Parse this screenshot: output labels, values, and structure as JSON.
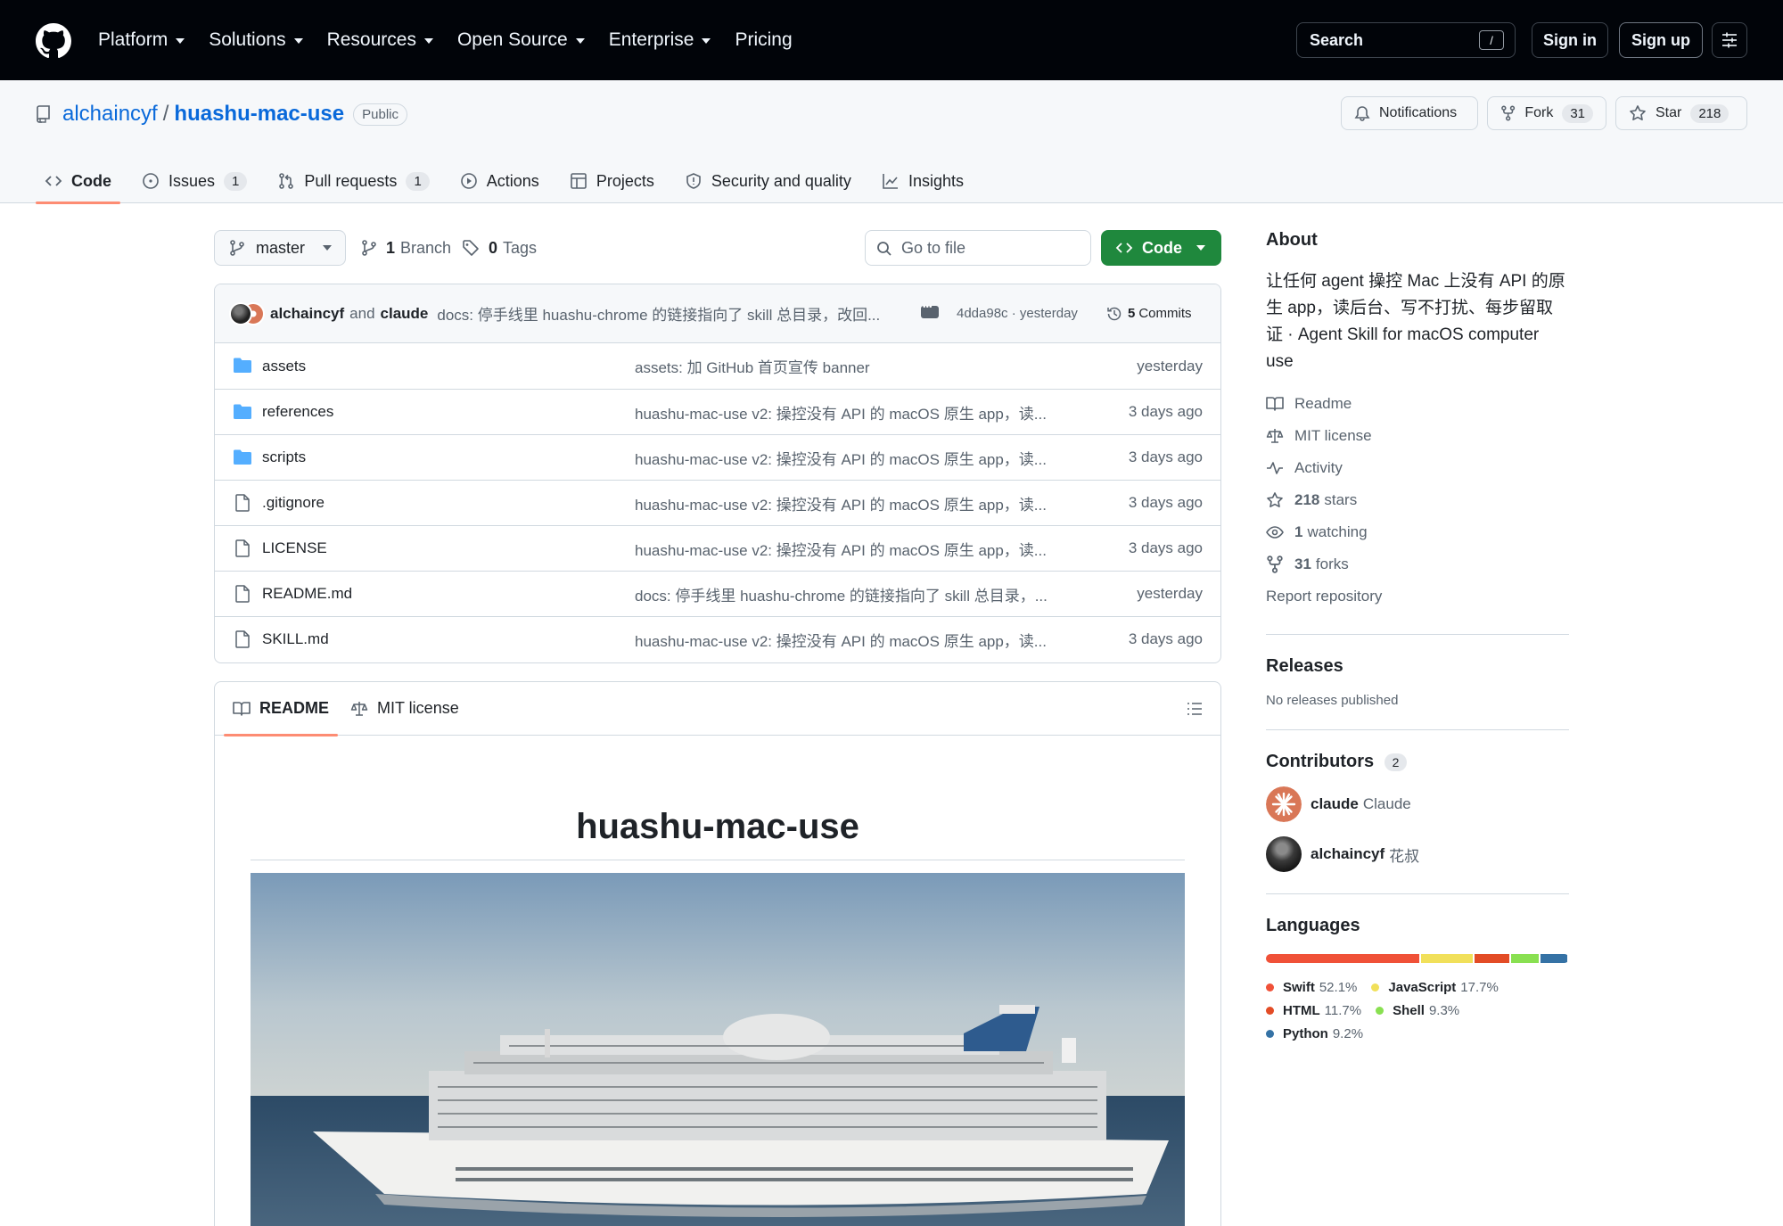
{
  "nav": {
    "items": [
      "Platform",
      "Solutions",
      "Resources",
      "Open Source",
      "Enterprise",
      "Pricing"
    ],
    "search_label": "Search",
    "search_key": "/",
    "sign_in": "Sign in",
    "sign_up": "Sign up"
  },
  "repo": {
    "owner": "alchaincyf",
    "separator": "/",
    "name": "huashu-mac-use",
    "visibility": "Public",
    "notifications_label": "Notifications",
    "fork_label": "Fork",
    "fork_count": "31",
    "star_label": "Star",
    "star_count": "218"
  },
  "tabs": [
    {
      "label": "Code",
      "icon": "code-icon",
      "count": ""
    },
    {
      "label": "Issues",
      "icon": "issue-icon",
      "count": "1"
    },
    {
      "label": "Pull requests",
      "icon": "pull-request-icon",
      "count": "1"
    },
    {
      "label": "Actions",
      "icon": "play-icon",
      "count": ""
    },
    {
      "label": "Projects",
      "icon": "table-icon",
      "count": ""
    },
    {
      "label": "Security and quality",
      "icon": "shield-icon",
      "count": ""
    },
    {
      "label": "Insights",
      "icon": "graph-icon",
      "count": ""
    }
  ],
  "toolbar": {
    "branch": "master",
    "branch_count": "1",
    "branch_label": "Branch",
    "tag_count": "0",
    "tag_label": "Tags",
    "goto_placeholder": "Go to file",
    "code_label": "Code"
  },
  "commit": {
    "author1": "alchaincyf",
    "and": "and",
    "author2": "claude",
    "message": "docs: 停手线里 huashu-chrome 的链接指向了 skill 总目录，改回...",
    "sha_time": "4dda98c · yesterday",
    "count": "5",
    "count_label": "Commits"
  },
  "files": [
    {
      "type": "folder",
      "name": "assets",
      "message": "assets: 加 GitHub 首页宣传 banner",
      "date": "yesterday"
    },
    {
      "type": "folder",
      "name": "references",
      "message": "huashu-mac-use v2: 操控没有 API 的 macOS 原生 app，读...",
      "date": "3 days ago"
    },
    {
      "type": "folder",
      "name": "scripts",
      "message": "huashu-mac-use v2: 操控没有 API 的 macOS 原生 app，读...",
      "date": "3 days ago"
    },
    {
      "type": "file",
      "name": ".gitignore",
      "message": "huashu-mac-use v2: 操控没有 API 的 macOS 原生 app，读...",
      "date": "3 days ago"
    },
    {
      "type": "file",
      "name": "LICENSE",
      "message": "huashu-mac-use v2: 操控没有 API 的 macOS 原生 app，读...",
      "date": "3 days ago"
    },
    {
      "type": "file",
      "name": "README.md",
      "message": "docs: 停手线里 huashu-chrome 的链接指向了 skill 总目录，...",
      "date": "yesterday"
    },
    {
      "type": "file",
      "name": "SKILL.md",
      "message": "huashu-mac-use v2: 操控没有 API 的 macOS 原生 app，读...",
      "date": "3 days ago"
    }
  ],
  "readme": {
    "tab_readme": "README",
    "tab_license": "MIT license",
    "title": "huashu-mac-use"
  },
  "about": {
    "heading": "About",
    "description": "让任何 agent 操控 Mac 上没有 API 的原生 app，读后台、写不打扰、每步留取证 · Agent Skill for macOS computer use",
    "readme": "Readme",
    "license": "MIT license",
    "activity": "Activity",
    "stars_count": "218",
    "stars_label": "stars",
    "watching_count": "1",
    "watching_label": "watching",
    "forks_count": "31",
    "forks_label": "forks",
    "report": "Report repository"
  },
  "releases": {
    "heading": "Releases",
    "empty": "No releases published"
  },
  "contributors": {
    "heading": "Contributors",
    "count": "2",
    "list": [
      {
        "login": "claude",
        "name": "Claude"
      },
      {
        "login": "alchaincyf",
        "name": "花叔"
      }
    ]
  },
  "languages": {
    "heading": "Languages",
    "list": [
      {
        "name": "Swift",
        "percent": "52.1%",
        "value": 52.1,
        "color": "#F05138"
      },
      {
        "name": "JavaScript",
        "percent": "17.7%",
        "value": 17.7,
        "color": "#f1e05a"
      },
      {
        "name": "HTML",
        "percent": "11.7%",
        "value": 11.7,
        "color": "#e34c26"
      },
      {
        "name": "Shell",
        "percent": "9.3%",
        "value": 9.3,
        "color": "#89e051"
      },
      {
        "name": "Python",
        "percent": "9.2%",
        "value": 9.2,
        "color": "#3572A5"
      }
    ]
  }
}
